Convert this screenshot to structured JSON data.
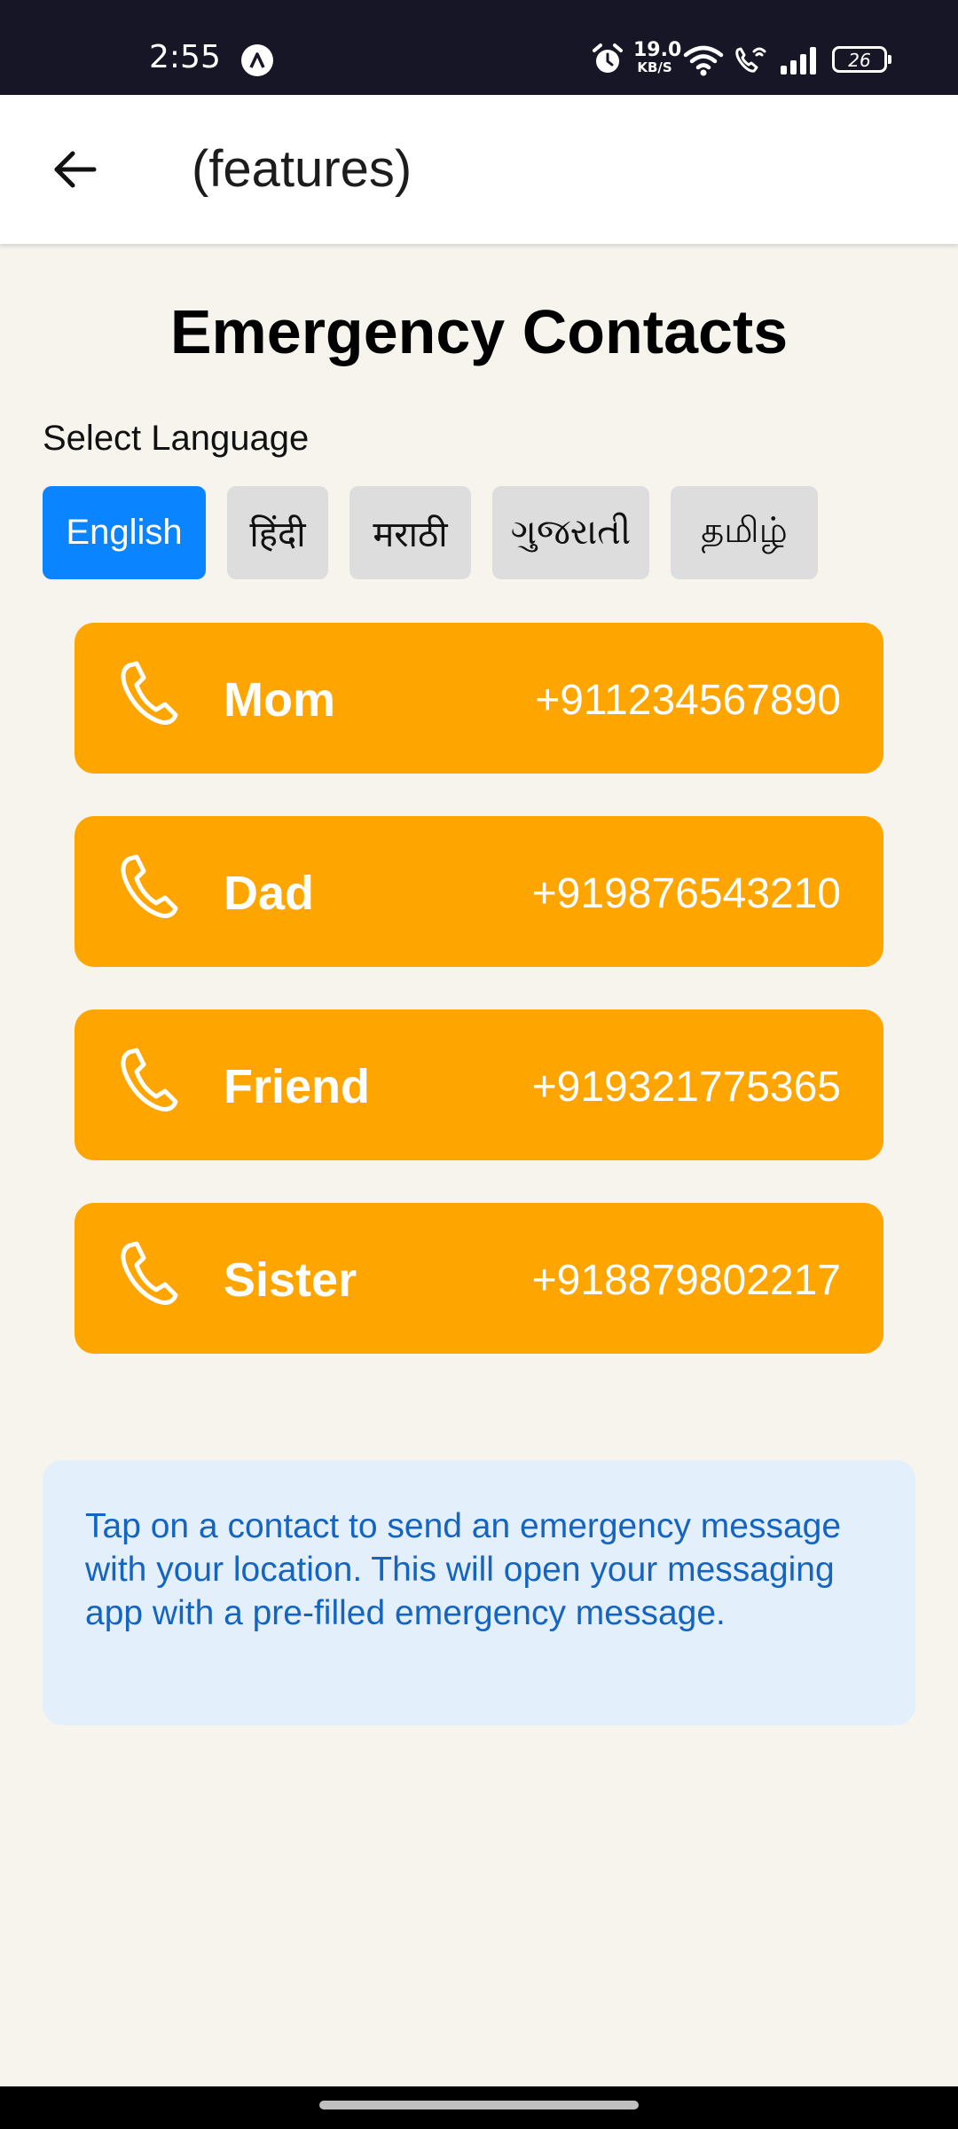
{
  "status_bar": {
    "time": "2:55",
    "net_speed_value": "19.0",
    "net_speed_unit": "KB/S",
    "battery": "26",
    "icons": [
      "app-indicator-icon",
      "alarm-icon",
      "wifi-icon",
      "wifi-calling-icon",
      "signal-icon",
      "battery-icon"
    ]
  },
  "app_bar": {
    "title": "(features)",
    "back_icon": "arrow-left-icon"
  },
  "page": {
    "heading": "Emergency Contacts",
    "language_label": "Select Language",
    "languages": [
      {
        "label": "English",
        "selected": true
      },
      {
        "label": "हिंदी",
        "selected": false
      },
      {
        "label": "मराठी",
        "selected": false
      },
      {
        "label": "ગુજરાતી",
        "selected": false
      },
      {
        "label": "தமிழ்",
        "selected": false
      }
    ],
    "contacts": [
      {
        "name": "Mom",
        "phone": "+911234567890"
      },
      {
        "name": "Dad",
        "phone": "+919876543210"
      },
      {
        "name": "Friend",
        "phone": "+919321775365"
      },
      {
        "name": "Sister",
        "phone": "+918879802217"
      }
    ],
    "info_text": "Tap on a contact to send an emergency message with your location. This will open your messaging app with a pre-filled emergency message."
  },
  "colors": {
    "status_bar_bg": "#161626",
    "page_bg": "#f7f4ee",
    "selected_language": "#0a84ff",
    "unselected_language": "#dddddd",
    "contact_card": "#ffa500",
    "info_bg": "#e3effb",
    "info_text": "#1565c0"
  }
}
